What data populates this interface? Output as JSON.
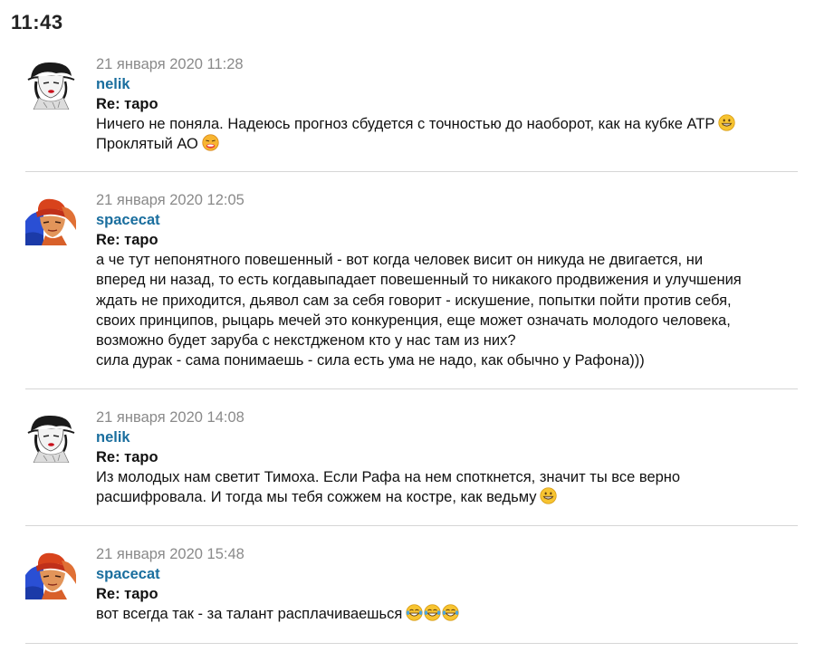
{
  "status_bar": {
    "time": "11:43"
  },
  "posts": [
    {
      "date": "21 января 2020 11:28",
      "author": "nelik",
      "subject": "Re: таро",
      "lines": [
        "Ничего не поняла. Надеюсь прогноз сбудется с точностью до наоборот, как на кубке АТР",
        "Проклятый АО"
      ],
      "emojis": [
        "grin-emoji",
        "sneeze-emoji"
      ]
    },
    {
      "date": "21 января 2020 12:05",
      "author": "spacecat",
      "subject": "Re: таро",
      "lines": [
        "а че тут непонятного повешенный - вот когда человек висит он никуда не двигается, ни",
        "вперед ни назад, то есть когдавыпадает повешенный то никакого продвижения и улучшения",
        "ждать не приходится, дьявол сам за себя говорит - искушение, попытки пойти против себя,",
        "своих принципов, рыцарь мечей это конкуренция, еще может означать молодого человека,",
        "возможно будет заруба с некстдженом кто у нас там из них?",
        "сила дурак - сама понимаешь - сила есть ума не надо, как обычно у Рафона)))"
      ]
    },
    {
      "date": "21 января 2020 14:08",
      "author": "nelik",
      "subject": "Re: таро",
      "lines": [
        "Из молодых нам светит Тимоха. Если Рафа на нем споткнется, значит ты все верно",
        "расшифровала. И тогда мы тебя сожжем на костре, как ведьму"
      ],
      "emojis": [
        "grin-emoji"
      ]
    },
    {
      "date": "21 января 2020 15:48",
      "author": "spacecat",
      "subject": "Re: таро",
      "lines": [
        "вот всегда так - за талант расплачиваешься"
      ],
      "emojis": [
        "tears-of-joy-emoji",
        "tears-of-joy-emoji",
        "tears-of-joy-emoji"
      ]
    }
  ],
  "colors": {
    "author_link": "#1a6e9e",
    "date_text": "#8a8a8a",
    "divider": "#d6d6d6",
    "emoji_fill": "#f7c431"
  }
}
